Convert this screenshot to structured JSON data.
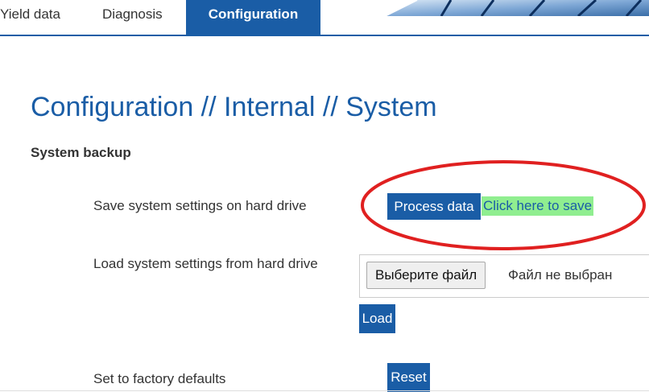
{
  "nav": {
    "tabs": [
      {
        "label": "Yield data",
        "active": false
      },
      {
        "label": "Diagnosis",
        "active": false
      },
      {
        "label": "Configuration",
        "active": true
      }
    ],
    "accent_color": "#1a5da6"
  },
  "page": {
    "title": "Configuration // Internal // System",
    "section_title": "System backup"
  },
  "rows": {
    "save": {
      "label": "Save system settings on hard drive",
      "button_label": "Process data",
      "link_label": "Click here to save",
      "link_bg": "#90ee90"
    },
    "load": {
      "label": "Load system settings from hard drive",
      "file_button_label": "Выберите файл",
      "file_status": "Файл не выбран",
      "button_label": "Load"
    },
    "reset": {
      "label": "Set to factory defaults",
      "button_label": "Reset"
    }
  },
  "annotation": {
    "shape": "ellipse",
    "color": "#e02020"
  }
}
